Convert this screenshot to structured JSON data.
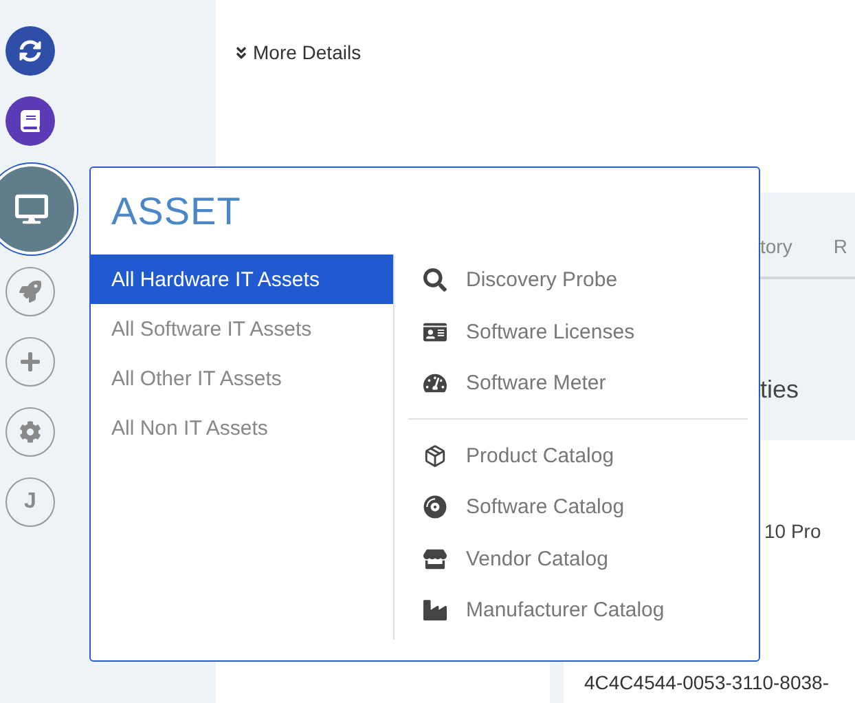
{
  "sidebar": {
    "top_items": [
      {
        "kind": "sync"
      },
      {
        "kind": "book"
      }
    ],
    "bottom_items": [
      {
        "kind": "rocket"
      },
      {
        "kind": "plus"
      },
      {
        "kind": "settings"
      },
      {
        "kind": "avatar",
        "label": "J"
      }
    ]
  },
  "details_link": {
    "label": "More Details"
  },
  "background_panel": {
    "tabs": [
      {
        "label": "tory",
        "selected": false
      },
      {
        "label": "R",
        "selected": false
      }
    ],
    "heading": "ties",
    "value": "10 Pro",
    "id": "4C4C4544-0053-3110-8038-"
  },
  "asset_menu": {
    "title": "ASSET",
    "categories": [
      {
        "label": "All Hardware IT Assets",
        "selected": true
      },
      {
        "label": "All Software IT Assets",
        "selected": false
      },
      {
        "label": "All Other IT Assets",
        "selected": false
      },
      {
        "label": "All Non IT Assets",
        "selected": false
      }
    ],
    "groups": [
      [
        {
          "kind": "probe",
          "label": "Discovery Probe"
        },
        {
          "kind": "license",
          "label": "Software Licenses"
        },
        {
          "kind": "meter",
          "label": "Software Meter"
        }
      ],
      [
        {
          "kind": "product",
          "label": "Product Catalog"
        },
        {
          "kind": "software",
          "label": "Software Catalog"
        },
        {
          "kind": "vendor",
          "label": "Vendor Catalog"
        },
        {
          "kind": "manufacturer",
          "label": "Manufacturer Catalog"
        }
      ]
    ]
  }
}
